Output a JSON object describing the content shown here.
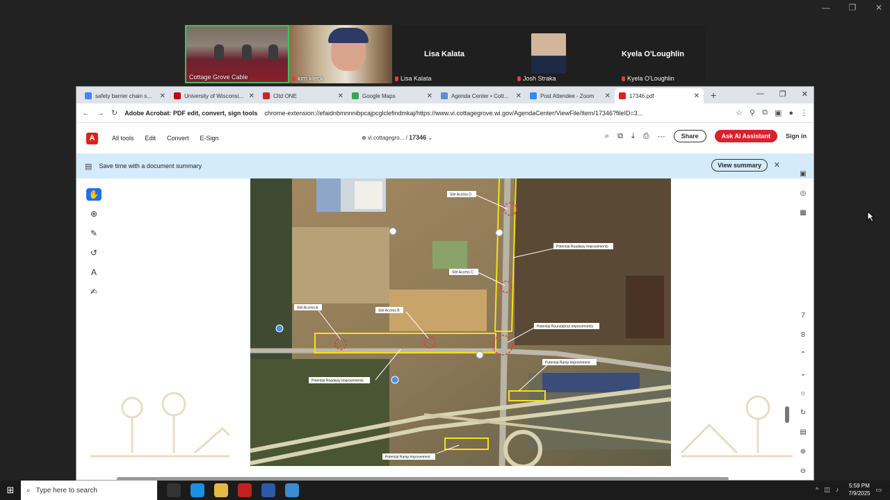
{
  "zoom_window": {
    "min": "—",
    "max": "❐",
    "close": "✕"
  },
  "gallery": [
    {
      "name": "Cottage Grove Cable"
    },
    {
      "name": "kim kieck"
    },
    {
      "big": "Lisa Kalata",
      "name": "Lisa Kalata"
    },
    {
      "name": "Josh Straka"
    },
    {
      "big": "Kyela O'Loughlin",
      "name": "Kyela O'Loughlin"
    }
  ],
  "browser": {
    "tabs": [
      {
        "label": "safety barrier chain s...",
        "color": "#4285f4"
      },
      {
        "label": "University of Wisconsi...",
        "color": "#c5050c"
      },
      {
        "label": "Cltd ONE",
        "color": "#c62828"
      },
      {
        "label": "Google Maps",
        "color": "#34a853"
      },
      {
        "label": "Agenda Center • Cott...",
        "color": "#5a8fd8"
      },
      {
        "label": "Post Attendee - Zoom",
        "color": "#2d8cff"
      },
      {
        "label": "17346.pdf",
        "color": "#d6241d"
      }
    ],
    "new_tab": "+",
    "url_chip": "Adobe Acrobat: PDF edit, convert, sign tools",
    "url": "chrome-extension://efaidnbmnnnibpcajpcglclefindmkaj/https://www.vi.cottagegrove.wi.gov/AgendaCenter/ViewFile/Item/17346?fileID=3..."
  },
  "acrobat": {
    "menu": [
      "All tools",
      "Edit",
      "Convert",
      "E-Sign"
    ],
    "site": "vi.cottagegro...",
    "sep": "/",
    "doc_name": "17346",
    "share": "Share",
    "ai": "Ask AI Assistant",
    "signin": "Sign in",
    "banner_text": "Save time with a document summary",
    "view_summary": "View summary",
    "page_numbers": [
      "7",
      "8"
    ]
  },
  "map_labels": {
    "site_access_d": "Site Access D",
    "site_access_c": "Site Access C",
    "site_access_a": "Site Access A",
    "site_access_b": "Site Access B",
    "roadway_1": "Potential Roadway Improvements",
    "roadway_2": "Potential Roadway Improvements",
    "roundabout": "Potential Roundabout Improvements",
    "ramp_1": "Potential Ramp Improvement",
    "ramp_2": "Potential Ramp Improvement"
  },
  "taskbar": {
    "search_placeholder": "Type here to search",
    "time": "5:59 PM",
    "date": "7/9/2025"
  }
}
